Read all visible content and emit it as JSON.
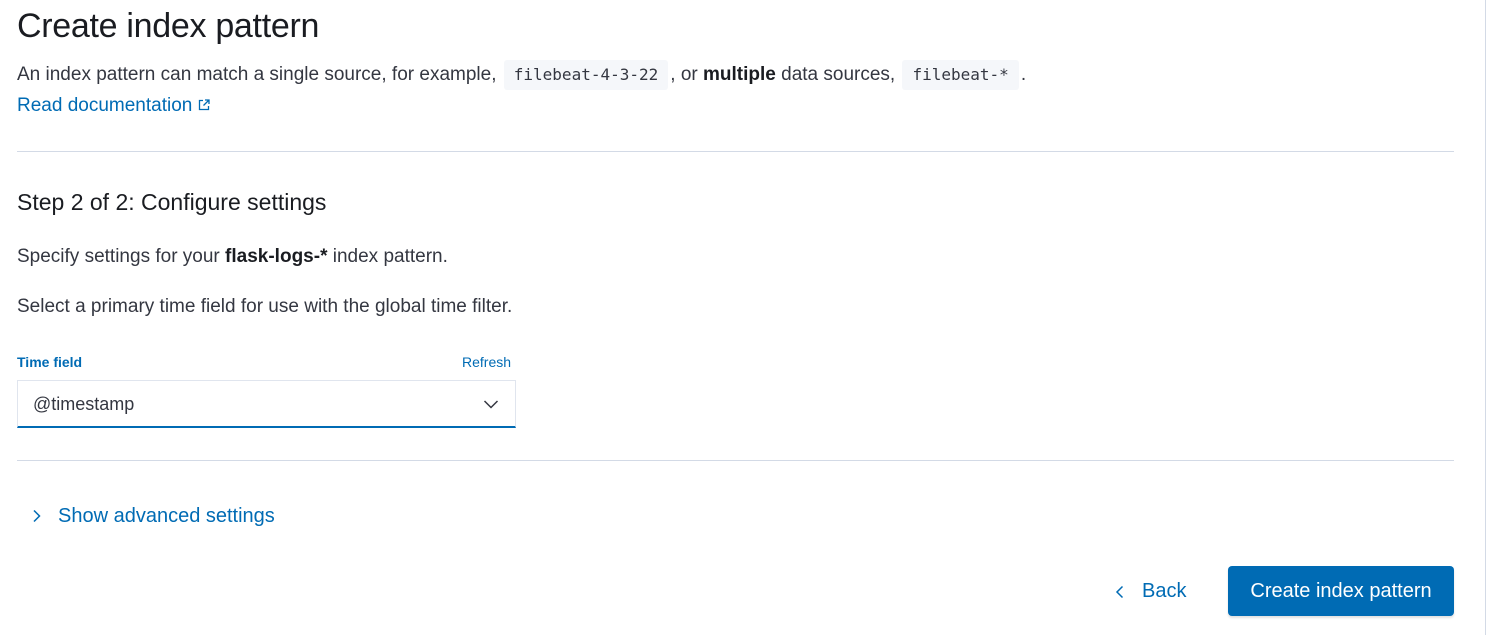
{
  "header": {
    "title": "Create index pattern",
    "intro_text_1": "An index pattern can match a single source, for example,",
    "example_single": "filebeat-4-3-22",
    "intro_text_2": ", or",
    "intro_bold": "multiple",
    "intro_text_3": "data sources,",
    "example_multiple": "filebeat-*",
    "intro_text_4": ".",
    "doc_link": "Read documentation",
    "doc_link_icon": "external-link-icon"
  },
  "step": {
    "title": "Step 2 of 2: Configure settings",
    "specify_prefix": "Specify settings for your",
    "pattern_name": "flask-logs-*",
    "specify_suffix": "index pattern.",
    "time_hint": "Select a primary time field for use with the global time filter."
  },
  "time_field": {
    "label": "Time field",
    "refresh_label": "Refresh",
    "selected_value": "@timestamp",
    "chevron_icon": "chevron-down-icon"
  },
  "advanced": {
    "label": "Show advanced settings",
    "icon": "chevron-right-icon"
  },
  "footer": {
    "back_label": "Back",
    "back_icon": "chevron-left-icon",
    "create_label": "Create index pattern"
  },
  "colors": {
    "primary": "#006bb4",
    "text": "#343741",
    "heading": "#1a1c21",
    "divider": "#d3dae6",
    "code_bg": "#f5f7fa"
  }
}
